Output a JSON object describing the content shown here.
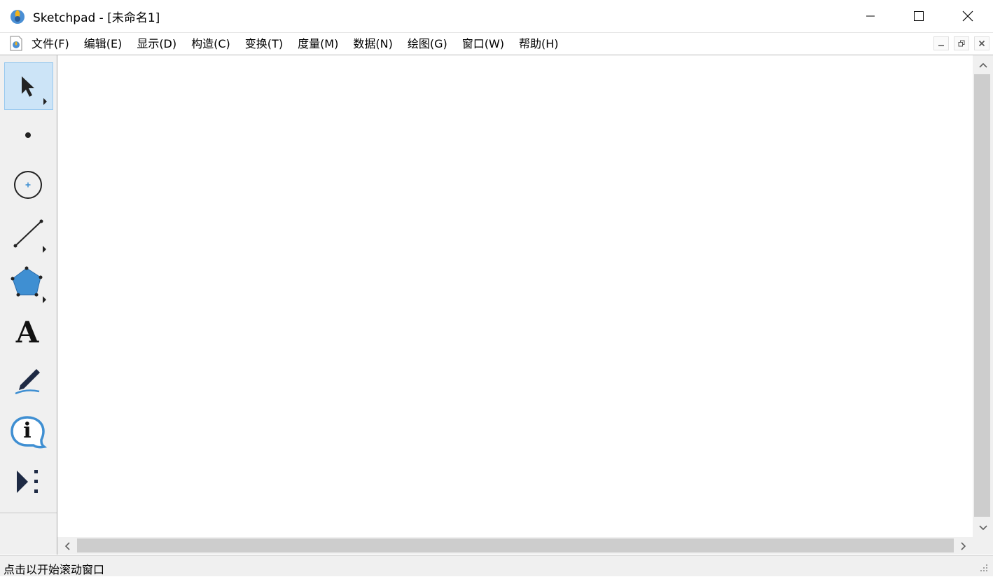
{
  "window": {
    "title": "Sketchpad  - [未命名1]",
    "controls": [
      "minimize",
      "maximize",
      "close"
    ]
  },
  "menu": {
    "items": [
      "文件(F)",
      "编辑(E)",
      "显示(D)",
      "构造(C)",
      "变换(T)",
      "度量(M)",
      "数据(N)",
      "绘图(G)",
      "窗口(W)",
      "帮助(H)"
    ]
  },
  "toolbox": {
    "tools": [
      {
        "name": "arrow-tool",
        "icon": "cursor-arrow-icon",
        "selected": true
      },
      {
        "name": "point-tool",
        "icon": "point-icon"
      },
      {
        "name": "compass-tool",
        "icon": "circle-icon"
      },
      {
        "name": "straightedge-tool",
        "icon": "segment-icon"
      },
      {
        "name": "polygon-tool",
        "icon": "pentagon-icon"
      },
      {
        "name": "text-tool",
        "icon": "text-a-icon"
      },
      {
        "name": "marker-tool",
        "icon": "marker-pen-icon"
      },
      {
        "name": "information-tool",
        "icon": "info-icon"
      },
      {
        "name": "custom-tool",
        "icon": "custom-tool-icon"
      }
    ],
    "text_tool_glyph": "A",
    "info_glyph": "i"
  },
  "status": {
    "text": "点击以开始滚动窗口"
  },
  "colors": {
    "accent_blue": "#3f8fd2",
    "selected_tool_bg": "#cce4f7",
    "toolbox_bg": "#f0f0f0"
  }
}
